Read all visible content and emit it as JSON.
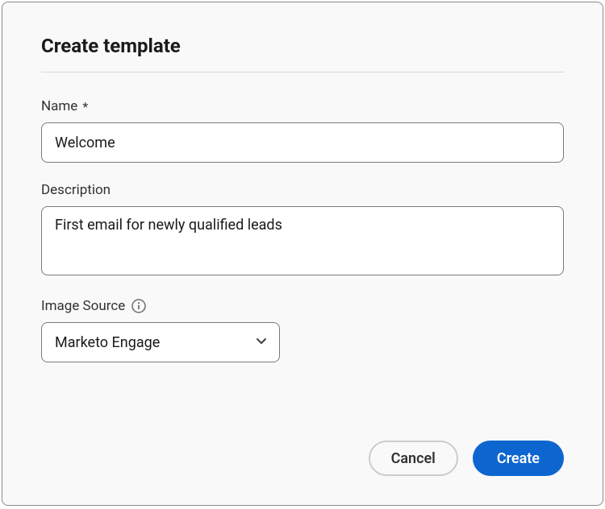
{
  "modal": {
    "title": "Create template"
  },
  "fields": {
    "name": {
      "label": "Name",
      "required_mark": "*",
      "value": "Welcome"
    },
    "description": {
      "label": "Description",
      "value": "First email for newly qualified leads"
    },
    "image_source": {
      "label": "Image Source",
      "selected": "Marketo Engage"
    }
  },
  "buttons": {
    "cancel": "Cancel",
    "create": "Create"
  },
  "colors": {
    "primary": "#0d66d0",
    "border": "#7a7a7a",
    "text": "#1a1a1a"
  }
}
